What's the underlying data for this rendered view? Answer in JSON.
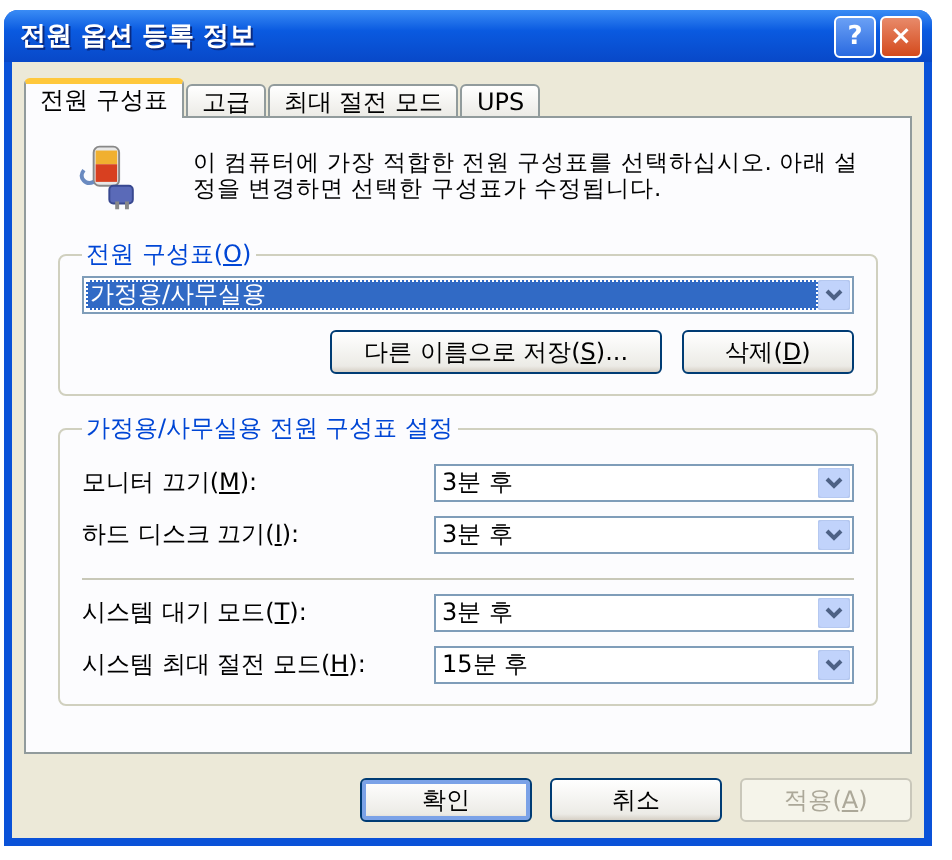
{
  "window": {
    "title": "전원 옵션 등록 정보"
  },
  "title_buttons": [
    {
      "kind": "help",
      "label": "?"
    },
    {
      "kind": "close",
      "label": "×"
    }
  ],
  "tabs": [
    {
      "label": "전원 구성표",
      "selected": true
    },
    {
      "label": "고급",
      "selected": false
    },
    {
      "label": "최대 절전 모드",
      "selected": false
    },
    {
      "label": "UPS",
      "selected": false
    }
  ],
  "description": "이 컴퓨터에 가장 적합한 전원 구성표를 선택하십시오. 아래 설정을 변경하면 선택한 구성표가 수정됩니다.",
  "scheme_group": {
    "legend": "전원 구성표(O)",
    "mnemonic_underlined": true,
    "selected_scheme": "가정용/사무실용",
    "buttons": [
      {
        "label": "다른 이름으로 저장(S)...",
        "mnemonic_underlined": true
      },
      {
        "label": "삭제(D)",
        "mnemonic_underlined": true
      }
    ]
  },
  "settings_group": {
    "legend": "가정용/사무실용 전원 구성표 설정",
    "sections": [
      [
        {
          "label": "모니터 끄기(M):",
          "mnemonic_underlined": true,
          "value": "3분 후"
        },
        {
          "label": "하드 디스크 끄기(I):",
          "mnemonic_underlined": true,
          "value": "3분 후"
        }
      ],
      [
        {
          "label": "시스템 대기 모드(T):",
          "mnemonic_underlined": true,
          "value": "3분 후"
        },
        {
          "label": "시스템 최대 절전 모드(H):",
          "mnemonic_underlined": true,
          "value": "15분 후"
        }
      ]
    ]
  },
  "dialog_buttons": [
    {
      "label": "확인",
      "disabled": false,
      "default": true
    },
    {
      "label": "취소",
      "disabled": false,
      "default": false
    },
    {
      "label": "적용(A)",
      "mnemonic_underlined": true,
      "disabled": true,
      "default": false
    }
  ]
}
